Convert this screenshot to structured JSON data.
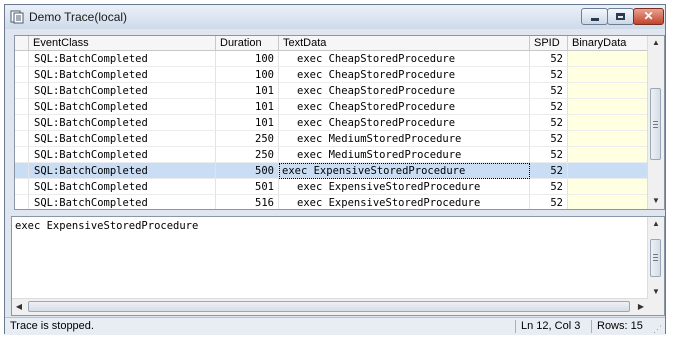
{
  "window": {
    "title": "Demo Trace(local)",
    "close_glyph": "✕"
  },
  "grid": {
    "columns": {
      "event": "EventClass",
      "duration": "Duration",
      "text": "TextData",
      "spid": "SPID",
      "binary": "BinaryData"
    },
    "rows": [
      {
        "event": "SQL:BatchCompleted",
        "duration": "100",
        "text": "exec CheapStoredProcedure",
        "spid": "52"
      },
      {
        "event": "SQL:BatchCompleted",
        "duration": "100",
        "text": "exec CheapStoredProcedure",
        "spid": "52"
      },
      {
        "event": "SQL:BatchCompleted",
        "duration": "101",
        "text": "exec CheapStoredProcedure",
        "spid": "52"
      },
      {
        "event": "SQL:BatchCompleted",
        "duration": "101",
        "text": "exec CheapStoredProcedure",
        "spid": "52"
      },
      {
        "event": "SQL:BatchCompleted",
        "duration": "101",
        "text": "exec CheapStoredProcedure",
        "spid": "52"
      },
      {
        "event": "SQL:BatchCompleted",
        "duration": "250",
        "text": "exec MediumStoredProcedure",
        "spid": "52"
      },
      {
        "event": "SQL:BatchCompleted",
        "duration": "250",
        "text": "exec MediumStoredProcedure",
        "spid": "52"
      },
      {
        "event": "SQL:BatchCompleted",
        "duration": "500",
        "text": "exec ExpensiveStoredProcedure",
        "spid": "52"
      },
      {
        "event": "SQL:BatchCompleted",
        "duration": "501",
        "text": "exec ExpensiveStoredProcedure",
        "spid": "52"
      },
      {
        "event": "SQL:BatchCompleted",
        "duration": "516",
        "text": "exec ExpensiveStoredProcedure",
        "spid": "52"
      }
    ],
    "selected_row_index": 7
  },
  "detail": {
    "text": "exec ExpensiveStoredProcedure"
  },
  "status": {
    "message": "Trace is stopped.",
    "position": "Ln 12, Col 3",
    "rows": "Rows: 15"
  },
  "scroll": {
    "up": "▲",
    "down": "▼",
    "left": "◀",
    "right": "▶"
  },
  "colors": {
    "selection": "#c9def5",
    "binary_column": "#ffffe2"
  }
}
